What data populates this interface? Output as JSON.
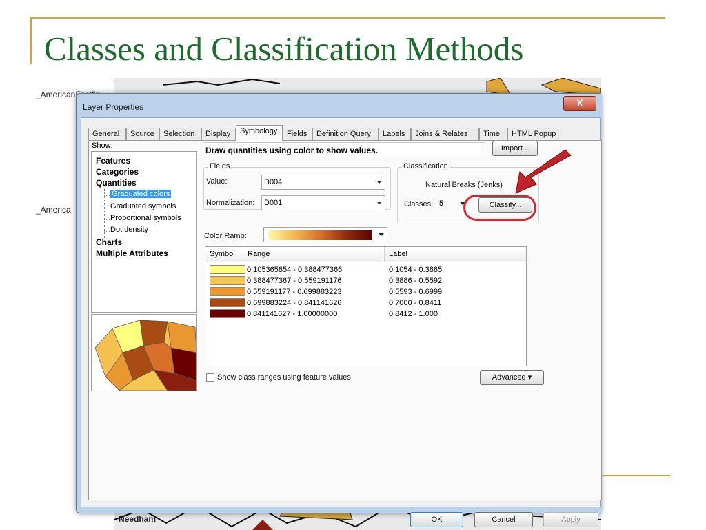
{
  "slide": {
    "title": "Classes and Classification Methods",
    "side_labels": [
      "_AmericanFactfin",
      "_America"
    ],
    "map_labels": [
      "Needham"
    ]
  },
  "dialog": {
    "title": "Layer Properties",
    "close_glyph": "X",
    "tabs": [
      "General",
      "Source",
      "Selection",
      "Display",
      "Symbology",
      "Fields",
      "Definition Query",
      "Labels",
      "Joins & Relates",
      "Time",
      "HTML Popup"
    ],
    "active_tab": "Symbology",
    "buttons": {
      "ok": "OK",
      "cancel": "Cancel",
      "apply": "Apply"
    }
  },
  "symbology": {
    "show_label": "Show:",
    "tree": {
      "features": "Features",
      "categories": "Categories",
      "quantities": "Quantities",
      "quantity_items": [
        "Graduated colors",
        "Graduated symbols",
        "Proportional symbols",
        "Dot density"
      ],
      "selected_item": "Graduated colors",
      "charts": "Charts",
      "multiple_attributes": "Multiple Attributes"
    },
    "description": "Draw quantities using color to show values.",
    "import_label": "Import...",
    "fields_group": "Fields",
    "value_label": "Value:",
    "value": "D004",
    "normalization_label": "Normalization:",
    "normalization": "D001",
    "classification_group": "Classification",
    "method": "Natural Breaks (Jenks)",
    "classes_label": "Classes:",
    "classes": "5",
    "classify_label": "Classify...",
    "color_ramp_label": "Color Ramp:",
    "table": {
      "headers": [
        "Symbol",
        "Range",
        "Label"
      ],
      "rows": [
        {
          "color": "#ffff80",
          "range": "0.105365854 - 0.388477366",
          "label": "0.1054 - 0.3885"
        },
        {
          "color": "#f5c750",
          "range": "0.388477367 - 0.559191176",
          "label": "0.3886 - 0.5592"
        },
        {
          "color": "#e8982e",
          "range": "0.559191177 - 0.699883223",
          "label": "0.5593 - 0.6999"
        },
        {
          "color": "#a94c14",
          "range": "0.699883224 - 0.841141626",
          "label": "0.7000 - 0.8411"
        },
        {
          "color": "#6b0000",
          "range": "0.841141627 - 1.00000000",
          "label": "0.8412 - 1.000"
        }
      ]
    },
    "show_ranges_label": "Show class ranges using feature values",
    "advanced_label": "Advanced",
    "advanced_arrow": "▾"
  },
  "colors": {
    "title": "#1f6b2e",
    "accent_line": "#d6a432",
    "highlight": "#e0202a",
    "selection": "#3399ff"
  }
}
